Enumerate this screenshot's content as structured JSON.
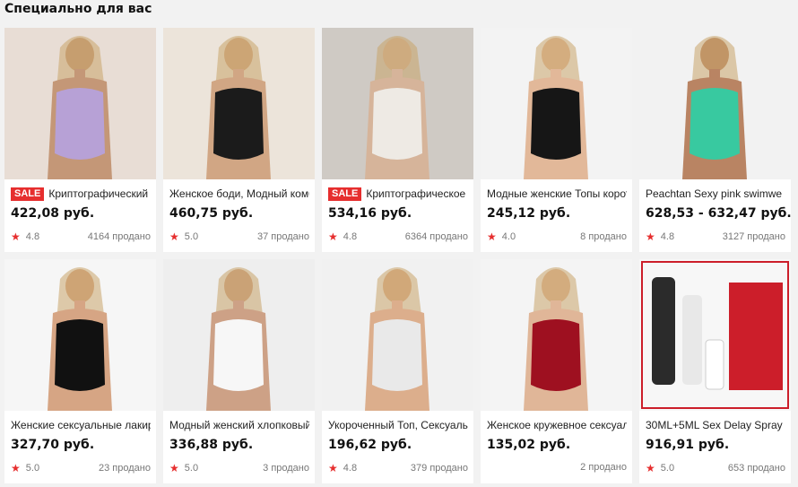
{
  "section_title": "Специально для вас",
  "products": [
    {
      "sale": "SALE",
      "title": "Криптографический",
      "price": "422,08 руб.",
      "rating": "4.8",
      "sold": "4164 продано",
      "palette": [
        "#e8ddd5",
        "#b7a1d6",
        "#c49777"
      ]
    },
    {
      "sale": "",
      "title": "Женское боди, Модный комб",
      "price": "460,75 руб.",
      "rating": "5.0",
      "sold": "37 продано",
      "palette": [
        "#ece4da",
        "#1b1b1b",
        "#d1a684"
      ]
    },
    {
      "sale": "SALE",
      "title": "Криптографическое",
      "price": "534,16 руб.",
      "rating": "4.8",
      "sold": "6364 продано",
      "palette": [
        "#cfcac4",
        "#eeeae4",
        "#d6b49a"
      ]
    },
    {
      "sale": "",
      "title": "Модные женские Топы корот",
      "price": "245,12 руб.",
      "rating": "4.0",
      "sold": "8 продано",
      "palette": [
        "#f3f3f3",
        "#161616",
        "#e2b899"
      ]
    },
    {
      "sale": "",
      "title": "Peachtan Sexy pink swimwe",
      "price": "628,53 - 632,47 руб.",
      "rating": "4.8",
      "sold": "3127 продано",
      "palette": [
        "#f2f2f2",
        "#38c9a0",
        "#b98463"
      ]
    },
    {
      "sale": "",
      "title": "Женские сексуальные лакир",
      "price": "327,70 руб.",
      "rating": "5.0",
      "sold": "23 продано",
      "palette": [
        "#f6f6f6",
        "#111111",
        "#d6a584"
      ]
    },
    {
      "sale": "",
      "title": "Модный женский хлопковый",
      "price": "336,88 руб.",
      "rating": "5.0",
      "sold": "3 продано",
      "palette": [
        "#eeeeee",
        "#f7f7f7",
        "#cda186"
      ]
    },
    {
      "sale": "",
      "title": "Укороченный Топ, Сексуаль",
      "price": "196,62 руб.",
      "rating": "4.8",
      "sold": "379 продано",
      "palette": [
        "#f1f1f1",
        "#e9e9e9",
        "#dcae8c"
      ]
    },
    {
      "sale": "",
      "title": "Женское кружевное сексуаль",
      "price": "135,02 руб.",
      "rating": "",
      "sold": "2 продано",
      "palette": [
        "#f4f4f4",
        "#9e1020",
        "#e0b698"
      ]
    },
    {
      "sale": "",
      "title": "30ML+5ML Sex Delay Spray",
      "price": "916,91 руб.",
      "rating": "5.0",
      "sold": "653 продано",
      "palette": [
        "#f7f7f7",
        "#cc1e2a",
        "#2b2b2b"
      ]
    }
  ]
}
